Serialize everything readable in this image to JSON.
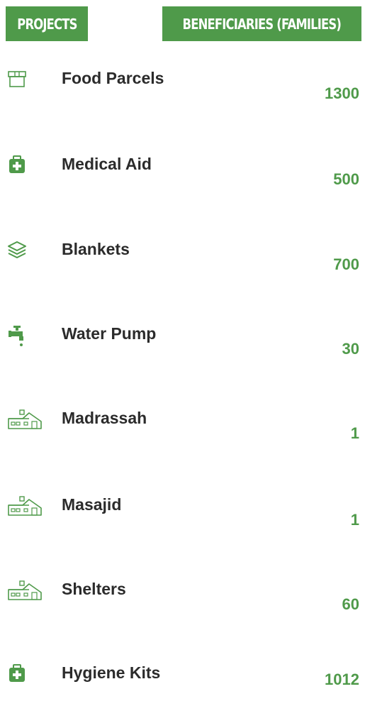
{
  "header": {
    "projects_label": "PROJECTS",
    "beneficiaries_label": "BENEFICIARIES (FAMILIES)"
  },
  "rows": [
    {
      "label": "Food Parcels",
      "value": "1300",
      "icon": "food-parcel-box-icon"
    },
    {
      "label": "Medical Aid",
      "value": "500",
      "icon": "medical-kit-icon"
    },
    {
      "label": "Blankets",
      "value": "700",
      "icon": "blanket-stack-icon"
    },
    {
      "label": "Water Pump",
      "value": "30",
      "icon": "water-tap-icon"
    },
    {
      "label": "Madrassah",
      "value": "1",
      "icon": "building-icon"
    },
    {
      "label": "Masajid",
      "value": "1",
      "icon": "building-icon"
    },
    {
      "label": "Shelters",
      "value": "60",
      "icon": "building-icon"
    },
    {
      "label": "Hygiene Kits",
      "value": "1012",
      "icon": "medical-kit-icon"
    }
  ],
  "colors": {
    "accent": "#4f9a4a",
    "text": "#2b2b2b"
  }
}
